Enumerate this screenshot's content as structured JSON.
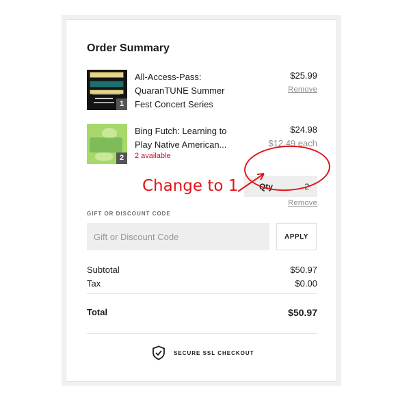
{
  "summary": {
    "title": "Order Summary"
  },
  "items": [
    {
      "name": "All-Access-Pass: QuaranTUNE Summer Fest Concert Series",
      "price": "$25.99",
      "qty_badge": "1",
      "remove_label": "Remove",
      "thumb_icon": "ticket-image"
    },
    {
      "name": "Bing Futch: Learning to Play Native American...",
      "price": "$24.98",
      "each_price": "$12.49 each",
      "availability": "2 available",
      "qty_badge": "2",
      "qty_label": "Qty",
      "qty_value": "2",
      "remove_label": "Remove",
      "thumb_icon": "saturday-session-image"
    }
  ],
  "annotation": {
    "text": "Change to 1",
    "color": "#e0161b"
  },
  "gift": {
    "label": "GIFT OR DISCOUNT CODE",
    "placeholder": "Gift or Discount Code",
    "apply_label": "APPLY"
  },
  "totals": {
    "subtotal_label": "Subtotal",
    "subtotal_value": "$50.97",
    "tax_label": "Tax",
    "tax_value": "$0.00",
    "total_label": "Total",
    "total_value": "$50.97"
  },
  "secure": {
    "label": "SECURE SSL CHECKOUT",
    "icon": "shield-check-icon"
  }
}
